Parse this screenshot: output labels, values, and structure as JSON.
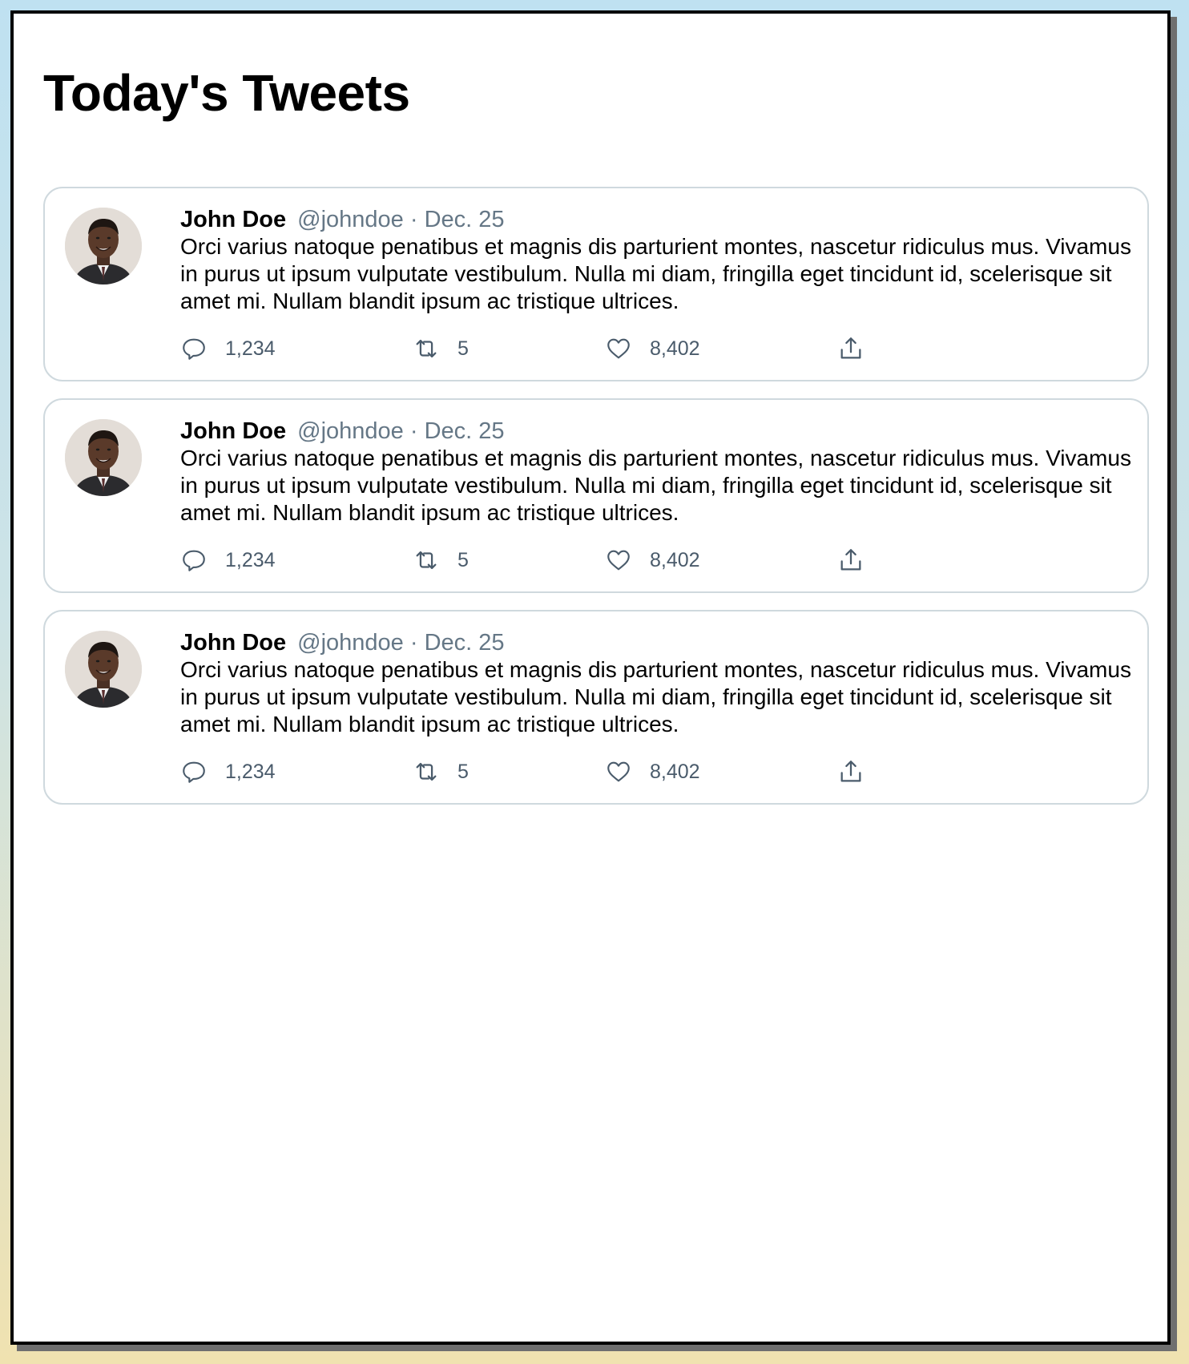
{
  "page": {
    "title": "Today's Tweets"
  },
  "colors": {
    "secondary_text": "#657786",
    "card_border": "#cfd9de",
    "action_color": "#4a5b6b"
  },
  "tweets": [
    {
      "author_name": "John Doe",
      "handle": "@johndoe",
      "separator": "·",
      "date": "Dec. 25",
      "text": "Orci varius natoque penatibus et magnis dis parturient montes, nascetur ridiculus mus. Vivamus in purus ut ipsum vulputate vestibulum. Nulla mi diam, fringilla eget tincidunt id, scelerisque sit amet mi. Nullam blandit ipsum ac tristique ultrices.",
      "replies": "1,234",
      "retweets": "5",
      "likes": "8,402"
    },
    {
      "author_name": "John Doe",
      "handle": "@johndoe",
      "separator": "·",
      "date": "Dec. 25",
      "text": "Orci varius natoque penatibus et magnis dis parturient montes, nascetur ridiculus mus. Vivamus in purus ut ipsum vulputate vestibulum. Nulla mi diam, fringilla eget tincidunt id, scelerisque sit amet mi. Nullam blandit ipsum ac tristique ultrices.",
      "replies": "1,234",
      "retweets": "5",
      "likes": "8,402"
    },
    {
      "author_name": "John Doe",
      "handle": "@johndoe",
      "separator": "·",
      "date": "Dec. 25",
      "text": "Orci varius natoque penatibus et magnis dis parturient montes, nascetur ridiculus mus. Vivamus in purus ut ipsum vulputate vestibulum. Nulla mi diam, fringilla eget tincidunt id, scelerisque sit amet mi. Nullam blandit ipsum ac tristique ultrices.",
      "replies": "1,234",
      "retweets": "5",
      "likes": "8,402"
    }
  ]
}
